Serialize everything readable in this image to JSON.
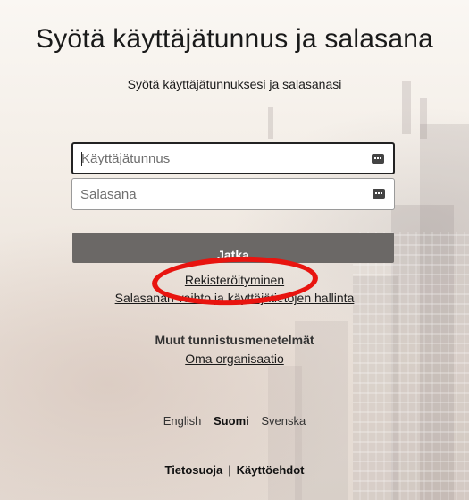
{
  "page": {
    "title": "Syötä käyttäjätunnus ja salasana",
    "subtitle": "Syötä käyttäjätunnuksesi ja salasanasi"
  },
  "form": {
    "username_placeholder": "Käyttäjätunnus",
    "password_placeholder": "Salasana",
    "submit_label": "Jatka"
  },
  "links": {
    "register": "Rekisteröityminen",
    "password_management": "Salasanan vaihto ja käyttäjätietojen hallinta"
  },
  "other_methods": {
    "title": "Muut tunnistusmenetelmät",
    "organization": "Oma organisaatio"
  },
  "languages": [
    {
      "label": "English",
      "active": false
    },
    {
      "label": "Suomi",
      "active": true
    },
    {
      "label": "Svenska",
      "active": false
    }
  ],
  "footer": {
    "privacy": "Tietosuoja",
    "separator": "|",
    "terms": "Käyttöehdot"
  },
  "colors": {
    "button_bg": "#6b6866",
    "highlight": "#e8140f"
  },
  "icons": [
    "password-manager-icon"
  ]
}
